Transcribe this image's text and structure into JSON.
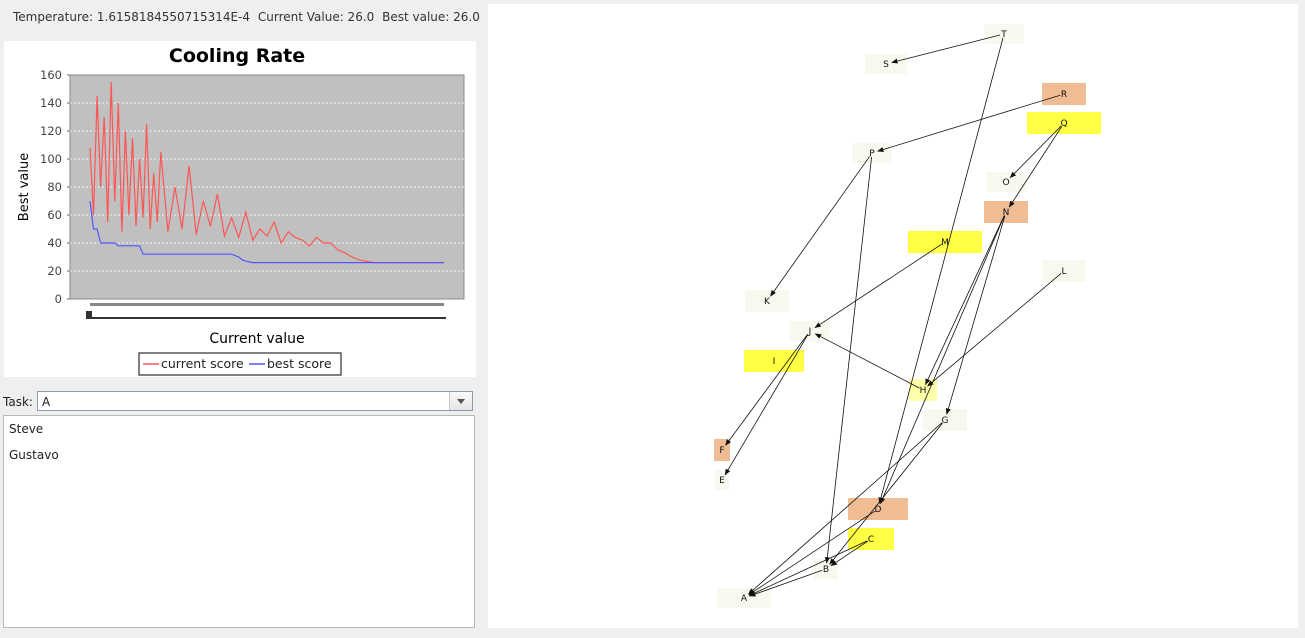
{
  "status": {
    "temperature": "Temperature: 1.6158184550715314E-4",
    "current_value": "Current Value: 26.0",
    "best_value": "Best value: 26.0"
  },
  "chart_data": {
    "type": "line",
    "title": "Cooling Rate",
    "xlabel": "Current value",
    "ylabel": "Best value",
    "ylim": [
      0,
      160
    ],
    "yticks": [
      "0",
      "20",
      "40",
      "60",
      "80",
      "100",
      "120",
      "140",
      "160"
    ],
    "grid": true,
    "legend_position": "bottom",
    "colors": {
      "current": "#ff5555",
      "best": "#5555ff",
      "plot_bg": "#c0c0c0"
    },
    "series": [
      {
        "name": "current score",
        "x": [
          0,
          1,
          2,
          3,
          4,
          5,
          6,
          7,
          8,
          9,
          10,
          11,
          12,
          13,
          14,
          15,
          16,
          17,
          18,
          19,
          20,
          22,
          24,
          26,
          28,
          30,
          32,
          34,
          36,
          38,
          40,
          42,
          44,
          46,
          48,
          50,
          52,
          54,
          56,
          58,
          60,
          62,
          64,
          66,
          68,
          70,
          72,
          74,
          76,
          78,
          80,
          84,
          88,
          92,
          96,
          100
        ],
        "values": [
          108,
          60,
          145,
          80,
          130,
          55,
          155,
          70,
          140,
          48,
          120,
          60,
          115,
          52,
          100,
          58,
          125,
          50,
          90,
          55,
          105,
          48,
          80,
          50,
          95,
          46,
          70,
          52,
          75,
          45,
          58,
          44,
          62,
          42,
          50,
          45,
          55,
          40,
          48,
          44,
          42,
          38,
          44,
          40,
          40,
          35,
          33,
          30,
          28,
          27,
          26,
          26,
          26,
          26,
          26,
          26
        ]
      },
      {
        "name": "best score",
        "x": [
          0,
          1,
          2,
          3,
          7,
          8,
          14,
          15,
          28,
          30,
          36,
          38,
          40,
          42,
          43,
          44,
          46,
          48,
          100
        ],
        "values": [
          70,
          50,
          50,
          40,
          40,
          38,
          38,
          32,
          32,
          32,
          32,
          32,
          32,
          30,
          28,
          27,
          26,
          26,
          26
        ]
      }
    ]
  },
  "task": {
    "label": "Task:",
    "selected": "A"
  },
  "employees": [
    "Steve",
    "Gustavo"
  ],
  "graph": {
    "nodes": [
      {
        "id": "T",
        "color": "#f8f8ee"
      },
      {
        "id": "S",
        "color": "#f8f8ee"
      },
      {
        "id": "R",
        "color": "#f0bc94"
      },
      {
        "id": "Q",
        "color": "#ffff44"
      },
      {
        "id": "P",
        "color": "#f8f8ee"
      },
      {
        "id": "O",
        "color": "#f8f8ee"
      },
      {
        "id": "N",
        "color": "#f0bc94"
      },
      {
        "id": "M",
        "color": "#ffff44"
      },
      {
        "id": "L",
        "color": "#f8f8ee"
      },
      {
        "id": "K",
        "color": "#f8f8ee"
      },
      {
        "id": "J",
        "color": "#f8f8ee"
      },
      {
        "id": "I",
        "color": "#ffff44"
      },
      {
        "id": "H",
        "color": "#ffffaa"
      },
      {
        "id": "G",
        "color": "#f8f8ee"
      },
      {
        "id": "F",
        "color": "#f0bc94"
      },
      {
        "id": "E",
        "color": "#f8f8ee"
      },
      {
        "id": "D",
        "color": "#f0bc94"
      },
      {
        "id": "C",
        "color": "#ffff44"
      },
      {
        "id": "B",
        "color": "#f8f8ee"
      },
      {
        "id": "A",
        "color": "#f8f8ee"
      }
    ],
    "edges": [
      [
        "T",
        "S"
      ],
      [
        "T",
        "D"
      ],
      [
        "R",
        "P"
      ],
      [
        "Q",
        "O"
      ],
      [
        "Q",
        "N"
      ],
      [
        "P",
        "K"
      ],
      [
        "P",
        "B"
      ],
      [
        "N",
        "H"
      ],
      [
        "N",
        "G"
      ],
      [
        "N",
        "D"
      ],
      [
        "M",
        "J"
      ],
      [
        "L",
        "H"
      ],
      [
        "J",
        "F"
      ],
      [
        "J",
        "E"
      ],
      [
        "H",
        "J"
      ],
      [
        "G",
        "B"
      ],
      [
        "G",
        "A"
      ],
      [
        "D",
        "A"
      ],
      [
        "C",
        "B"
      ],
      [
        "C",
        "A"
      ],
      [
        "B",
        "A"
      ]
    ]
  }
}
